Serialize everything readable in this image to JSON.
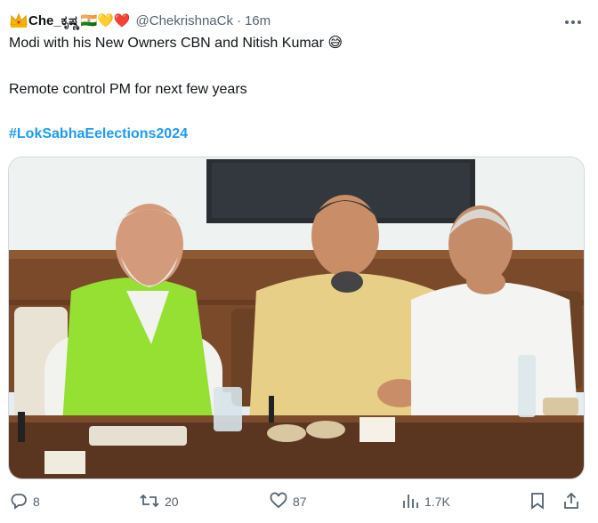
{
  "tweet": {
    "display_name": "Che_ಕೃಷ್ಣ",
    "name_emoji": "🇮🇳💛❤️",
    "handle": "@ChekrishnaCk",
    "separator": "·",
    "time": "16m",
    "line1": "Modi with his New Owners CBN and Nitish Kumar 😅",
    "line2": "Remote control PM for next few years",
    "hashtag": "#LokSabhaEelections2024"
  },
  "actions": {
    "replies": "8",
    "reposts": "20",
    "likes": "87",
    "views": "1.7K"
  },
  "icons": [
    "crown-icon",
    "more-icon",
    "reply-icon",
    "repost-icon",
    "like-icon",
    "views-icon",
    "bookmark-icon",
    "share-icon"
  ],
  "colors": {
    "link": "#1d9bf0",
    "muted": "#536471",
    "text": "#0f1419"
  }
}
